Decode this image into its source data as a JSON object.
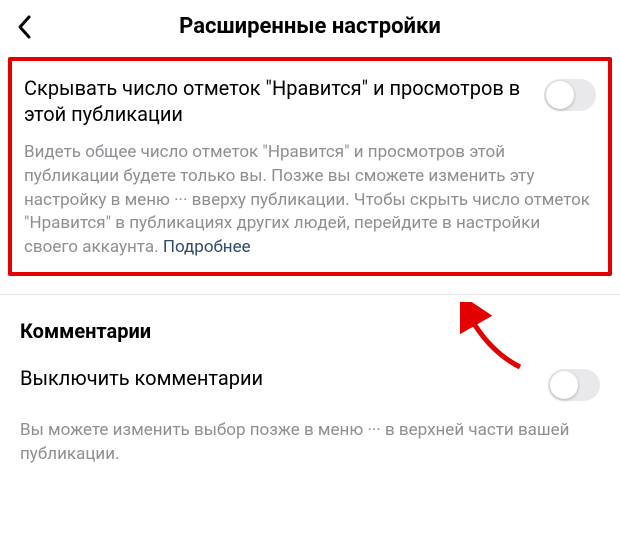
{
  "header": {
    "title": "Расширенные настройки"
  },
  "hideLikes": {
    "title": "Скрывать число отметок \"Нравится\" и просмотров в этой публикации",
    "description": "Видеть общее число отметок \"Нравится\" и просмотров этой публикации будете только вы. Позже вы сможете изменить эту настройку в меню ··· вверху публикации. Чтобы скрыть число отметок \"Нравится\" в публикациях других людей, перейдите в настройки своего аккаунта. ",
    "learnMore": "Подробнее"
  },
  "comments": {
    "sectionTitle": "Комментарии",
    "toggleTitle": "Выключить комментарии",
    "description": "Вы можете изменить выбор позже в меню ··· в верхней части вашей публикации."
  }
}
